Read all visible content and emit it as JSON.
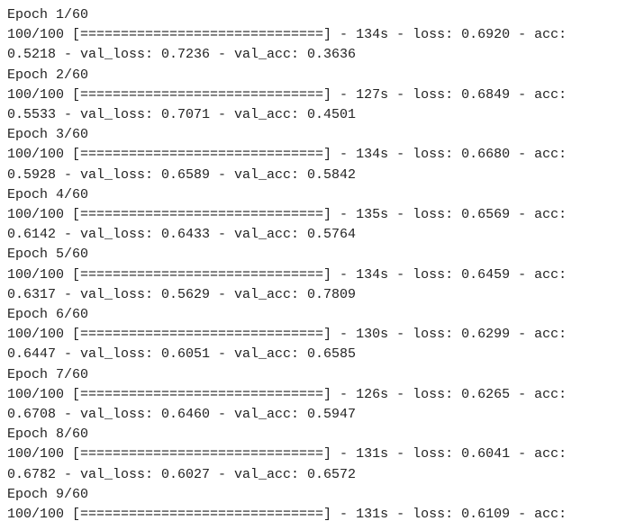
{
  "total_epochs": 60,
  "steps_per_epoch": 100,
  "progress_bar_full": "[==============================]",
  "epochs": [
    {
      "epoch": 1,
      "time": "134s",
      "loss": "0.6920",
      "acc": "0.5218",
      "val_loss": "0.7236",
      "val_acc": "0.3636"
    },
    {
      "epoch": 2,
      "time": "127s",
      "loss": "0.6849",
      "acc": "0.5533",
      "val_loss": "0.7071",
      "val_acc": "0.4501"
    },
    {
      "epoch": 3,
      "time": "134s",
      "loss": "0.6680",
      "acc": "0.5928",
      "val_loss": "0.6589",
      "val_acc": "0.5842"
    },
    {
      "epoch": 4,
      "time": "135s",
      "loss": "0.6569",
      "acc": "0.6142",
      "val_loss": "0.6433",
      "val_acc": "0.5764"
    },
    {
      "epoch": 5,
      "time": "134s",
      "loss": "0.6459",
      "acc": "0.6317",
      "val_loss": "0.5629",
      "val_acc": "0.7809"
    },
    {
      "epoch": 6,
      "time": "130s",
      "loss": "0.6299",
      "acc": "0.6447",
      "val_loss": "0.6051",
      "val_acc": "0.6585"
    },
    {
      "epoch": 7,
      "time": "126s",
      "loss": "0.6265",
      "acc": "0.6708",
      "val_loss": "0.6460",
      "val_acc": "0.5947"
    },
    {
      "epoch": 8,
      "time": "131s",
      "loss": "0.6041",
      "acc": "0.6782",
      "val_loss": "0.6027",
      "val_acc": "0.6572"
    }
  ],
  "partial": {
    "epoch": 9,
    "time": "131s",
    "loss": "0.6109"
  }
}
